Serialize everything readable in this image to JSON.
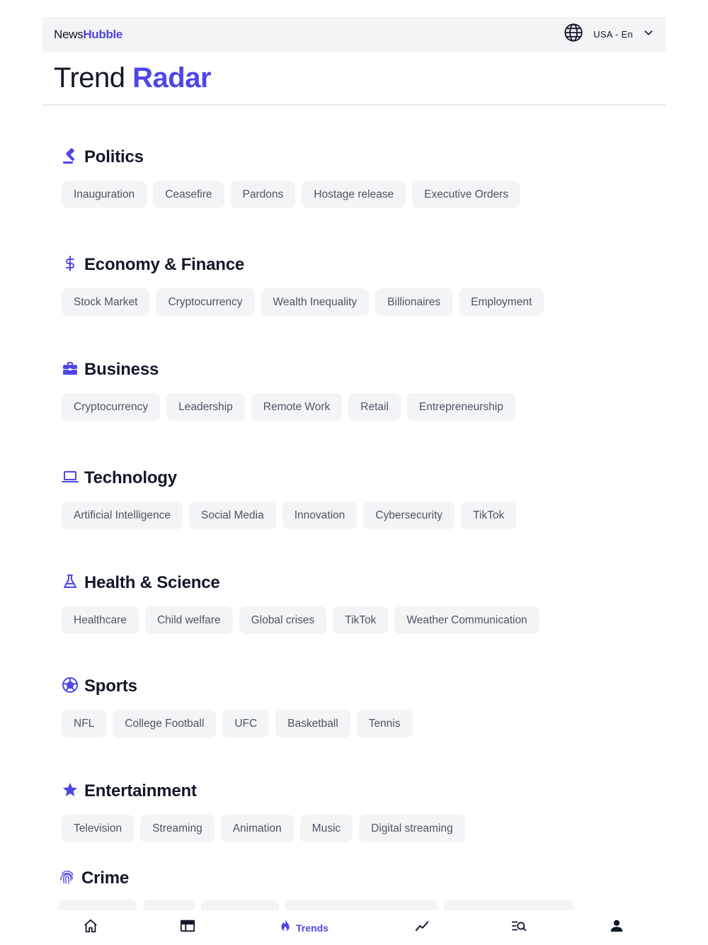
{
  "header": {
    "logo_part1": "News",
    "logo_part2": "Hubble",
    "locale": "USA - En"
  },
  "page": {
    "title_part1": "Trend",
    "title_part2": "Radar"
  },
  "colors": {
    "accent": "#4f46e5",
    "chip_bg": "#f3f4f6",
    "chip_text": "#4b5563"
  },
  "sections": [
    {
      "title": "Politics",
      "icon": "gavel-icon",
      "tags": [
        "Inauguration",
        "Ceasefire",
        "Pardons",
        "Hostage release",
        "Executive Orders"
      ]
    },
    {
      "title": "Economy & Finance",
      "icon": "dollar-icon",
      "tags": [
        "Stock Market",
        "Cryptocurrency",
        "Wealth Inequality",
        "Billionaires",
        "Employment"
      ]
    },
    {
      "title": "Business",
      "icon": "briefcase-icon",
      "tags": [
        "Cryptocurrency",
        "Leadership",
        "Remote Work",
        "Retail",
        "Entrepreneurship"
      ]
    },
    {
      "title": "Technology",
      "icon": "laptop-icon",
      "tags": [
        "Artificial Intelligence",
        "Social Media",
        "Innovation",
        "Cybersecurity",
        "TikTok"
      ]
    },
    {
      "title": "Health & Science",
      "icon": "flask-icon",
      "tags": [
        "Healthcare",
        "Child welfare",
        "Global crises",
        "TikTok",
        "Weather Communication"
      ]
    },
    {
      "title": "Sports",
      "icon": "ball-icon",
      "tags": [
        "NFL",
        "College Football",
        "UFC",
        "Basketball",
        "Tennis"
      ]
    },
    {
      "title": "Entertainment",
      "icon": "star-icon",
      "tags": [
        "Television",
        "Streaming",
        "Animation",
        "Music",
        "Digital streaming"
      ]
    },
    {
      "title": "Crime",
      "icon": "fingerprint-icon",
      "tags": []
    }
  ],
  "nav": {
    "items": [
      {
        "icon": "home-icon"
      },
      {
        "icon": "newspaper-icon"
      },
      {
        "icon": "fire-icon",
        "label": "Trends",
        "active": true
      },
      {
        "icon": "trend-line-icon"
      },
      {
        "icon": "search-list-icon"
      },
      {
        "icon": "user-icon"
      }
    ]
  }
}
